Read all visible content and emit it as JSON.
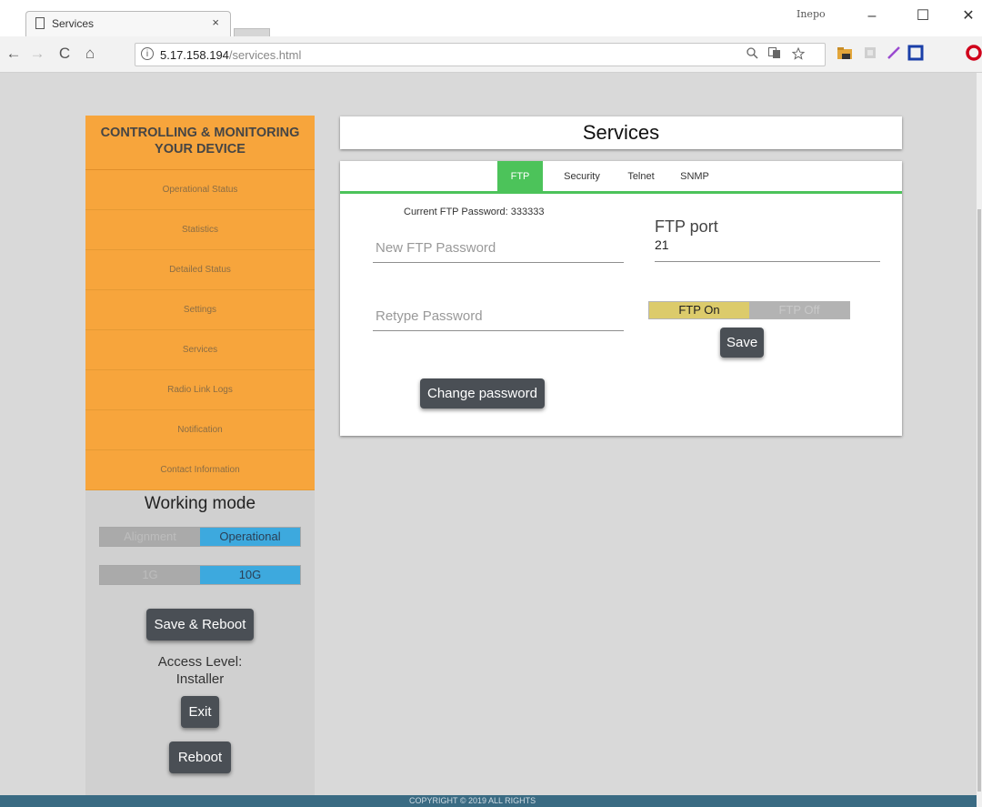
{
  "browser": {
    "tab_title": "Services",
    "tab_close": "×",
    "profile_name": "Inepo",
    "window_controls": {
      "minimize": "–",
      "maximize": "☐",
      "close": "✕"
    },
    "nav": {
      "back": "←",
      "forward": "→",
      "reload": "C",
      "home": "⌂"
    },
    "info_glyph": "i",
    "url_host": "5.17.158.194",
    "url_path": "/services.html",
    "address_icons": [
      "zoom-icon",
      "translate-icon",
      "star-icon"
    ]
  },
  "sidebar": {
    "header": "CONTROLLING & MONITORING YOUR DEVICE",
    "items": [
      {
        "label": "Operational Status"
      },
      {
        "label": "Statistics"
      },
      {
        "label": "Detailed Status"
      },
      {
        "label": "Settings"
      },
      {
        "label": "Services"
      },
      {
        "label": "Radio Link Logs"
      },
      {
        "label": "Notification"
      },
      {
        "label": "Contact Information"
      }
    ],
    "working_mode": {
      "title": "Working mode",
      "mode_options": [
        "Alignment",
        "Operational"
      ],
      "mode_selected": "Operational",
      "speed_options": [
        "1G",
        "10G"
      ],
      "speed_selected": "10G"
    },
    "save_reboot_label": "Save & Reboot",
    "access_label": "Access Level:",
    "access_value": "Installer",
    "exit_label": "Exit",
    "reboot_label": "Reboot"
  },
  "main": {
    "title": "Services",
    "tabs": [
      {
        "label": "FTP",
        "active": true
      },
      {
        "label": "Security",
        "active": false
      },
      {
        "label": "Telnet",
        "active": false
      },
      {
        "label": "SNMP",
        "active": false
      }
    ],
    "ftp": {
      "current_password_text": "Current FTP Password: 333333",
      "new_password_placeholder": "New FTP Password",
      "retype_password_placeholder": "Retype Password",
      "change_password_label": "Change password",
      "port_label": "FTP port",
      "port_value": "21",
      "ftp_on_label": "FTP On",
      "ftp_off_label": "FTP Off",
      "ftp_state": "On",
      "save_label": "Save"
    }
  },
  "footer": {
    "text": "COPYRIGHT © 2019 ALL RIGHTS"
  },
  "colors": {
    "sidebar_orange": "#f7a53c",
    "active_tab_green": "#4cc35a",
    "toggle_blue": "#3da9de",
    "ftp_on_yellow": "#dccb6b",
    "dark_button": "#4a4f55",
    "footer_teal": "#3a6b83"
  }
}
